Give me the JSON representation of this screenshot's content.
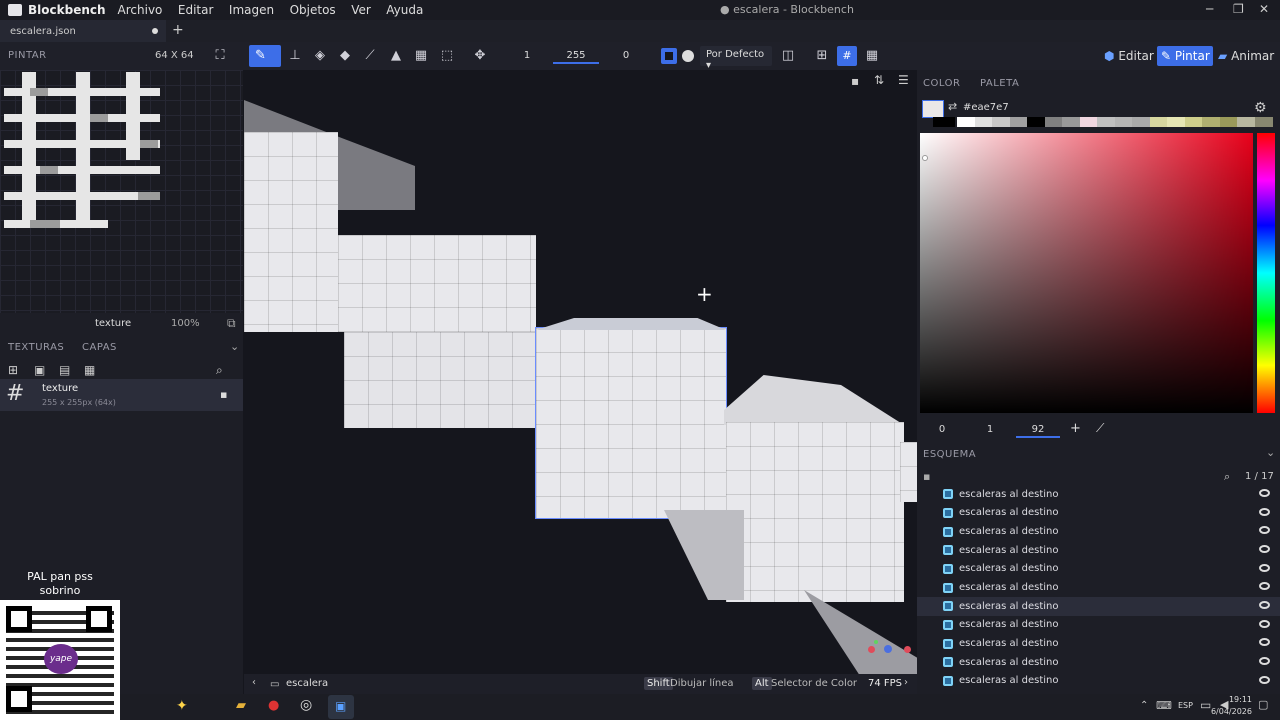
{
  "app": {
    "name": "Blockbench",
    "menus": [
      "Archivo",
      "Editar",
      "Imagen",
      "Objetos",
      "Ver",
      "Ayuda"
    ],
    "window_title": "● escalera - Blockbench",
    "window_buttons": [
      "─",
      "❐",
      "✕"
    ]
  },
  "tab": {
    "file": "escalera.json",
    "new_tab": "+"
  },
  "toolbar": {
    "panel_label": "PINTAR",
    "texture_size": "64 X 64",
    "brush_size": "1",
    "opacity": "255",
    "softness": "0",
    "blend_mode": "Por Defecto",
    "modes": {
      "edit": "Editar",
      "paint": "Pintar",
      "animate": "Animar"
    }
  },
  "left": {
    "texture_name": "texture",
    "zoom": "100%",
    "tabs": [
      "TEXTURAS",
      "CAPAS"
    ],
    "texture_item": {
      "name": "texture",
      "meta": "255 x 255px (64x)"
    }
  },
  "overlay": {
    "donation_text": "PAL pan pss sobrino",
    "qr_badge": "yape"
  },
  "color": {
    "tabs": [
      "COLOR",
      "PALETA"
    ],
    "hex": "#eae7e7",
    "hsv": [
      "0",
      "1",
      "92"
    ],
    "accent": "#3d6ee8",
    "palette": [
      "#ffffff",
      "#e0e0e0",
      "#c8c8c8",
      "#a0a0a0",
      "#000000",
      "#808080",
      "#999999",
      "#f0d7e0",
      "#c0c0c0",
      "#b5b5b5",
      "#aaaaaa",
      "#d7d7a0",
      "#e6e6b4",
      "#cfcf8c",
      "#b0b070",
      "#9a9a5a",
      "#b8b8a0",
      "#888870"
    ]
  },
  "outline": {
    "title": "ESQUEMA",
    "count": "1 / 17",
    "items": [
      "escaleras al destino",
      "escaleras al destino",
      "escaleras al destino",
      "escaleras al destino",
      "escaleras al destino",
      "escaleras al destino",
      "escaleras al destino",
      "escaleras al destino",
      "escaleras al destino",
      "escaleras al destino",
      "escaleras al destino"
    ],
    "selected_index": 6
  },
  "status": {
    "project": "escalera",
    "hint1_key": "Shift",
    "hint1": "Dibujar línea",
    "hint2_key": "Alt",
    "hint2": "Selector de Color",
    "fps": "74 FPS"
  },
  "taskbar": {
    "lang": "ESP",
    "time": "19:11",
    "date": "6/04/2026"
  }
}
